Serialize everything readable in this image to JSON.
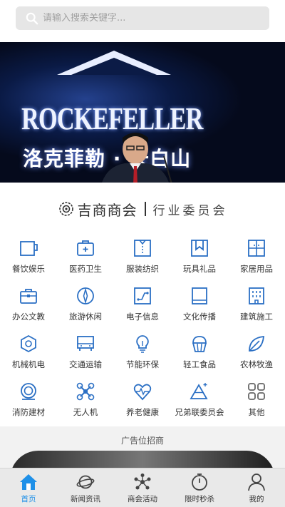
{
  "search": {
    "placeholder": "请输入搜索关键字..."
  },
  "banner": {
    "logo_text": "ROCKEFELLER",
    "cn_text": "洛克菲勒 · 长白山",
    "dot_count": 6,
    "active_dot": 2
  },
  "committee": {
    "brand": "吉商商会",
    "subtitle": "行业委员会"
  },
  "categories": [
    {
      "label": "餐饮娱乐",
      "icon": "cup-icon"
    },
    {
      "label": "医药卫生",
      "icon": "medical-kit-icon"
    },
    {
      "label": "服装纺织",
      "icon": "clothing-icon"
    },
    {
      "label": "玩具礼品",
      "icon": "gift-bookmark-icon"
    },
    {
      "label": "家居用品",
      "icon": "wardrobe-icon"
    },
    {
      "label": "办公文教",
      "icon": "briefcase-icon"
    },
    {
      "label": "旅游休闲",
      "icon": "compass-icon"
    },
    {
      "label": "电子信息",
      "icon": "circuit-icon"
    },
    {
      "label": "文化传播",
      "icon": "book-icon"
    },
    {
      "label": "建筑施工",
      "icon": "building-icon"
    },
    {
      "label": "机械机电",
      "icon": "hex-nut-icon"
    },
    {
      "label": "交通运输",
      "icon": "vehicle-icon"
    },
    {
      "label": "节能环保",
      "icon": "lightbulb-icon"
    },
    {
      "label": "轻工食品",
      "icon": "cupcake-icon"
    },
    {
      "label": "农林牧渔",
      "icon": "leaf-icon"
    },
    {
      "label": "消防建材",
      "icon": "fire-hose-icon"
    },
    {
      "label": "无人机",
      "icon": "drone-icon"
    },
    {
      "label": "养老健康",
      "icon": "heart-pulse-icon"
    },
    {
      "label": "兄弟联委员会",
      "icon": "triangle-icon"
    },
    {
      "label": "其他",
      "icon": "grid-icon"
    }
  ],
  "ad": {
    "title": "广告位招商"
  },
  "tabs": [
    {
      "label": "首页",
      "icon": "home-icon",
      "active": true
    },
    {
      "label": "新闻资讯",
      "icon": "planet-icon",
      "active": false
    },
    {
      "label": "商会活动",
      "icon": "network-icon",
      "active": false
    },
    {
      "label": "限时秒杀",
      "icon": "stopwatch-icon",
      "active": false
    },
    {
      "label": "我的",
      "icon": "user-icon",
      "active": false
    }
  ],
  "colors": {
    "accent": "#1e90e8",
    "icon_blue": "#2a6fc4",
    "text": "#333333"
  }
}
